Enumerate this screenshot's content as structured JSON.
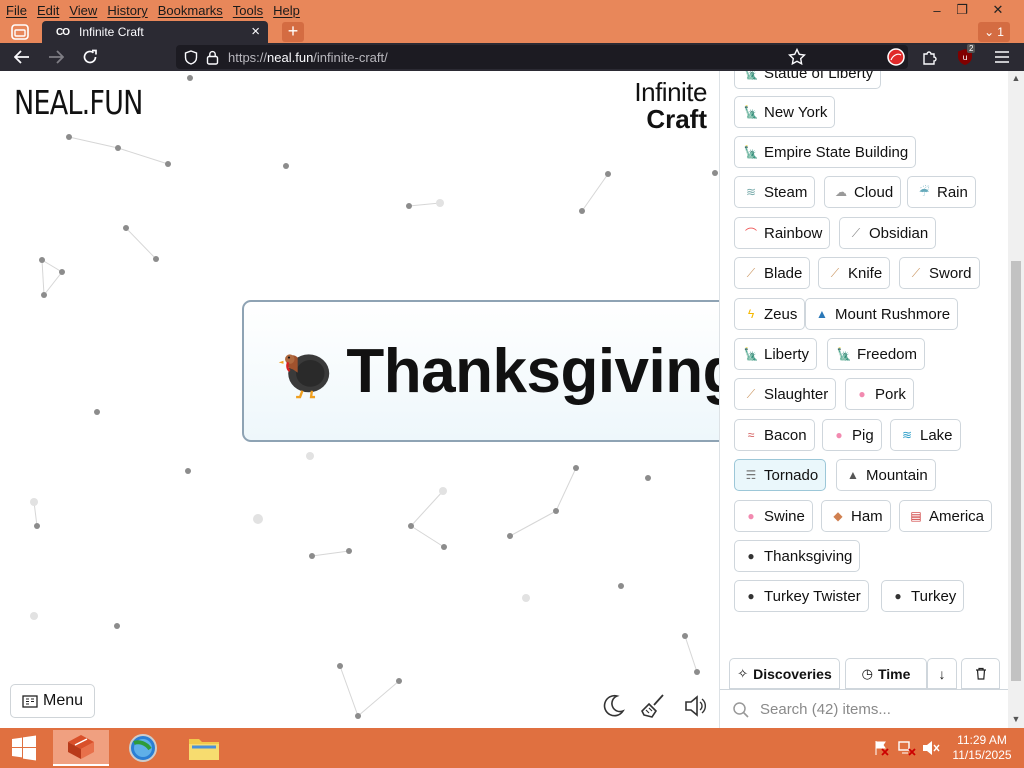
{
  "menubar": {
    "items": [
      "File",
      "Edit",
      "View",
      "History",
      "Bookmarks",
      "Tools",
      "Help"
    ]
  },
  "window_controls": [
    "–",
    "❐",
    "✕"
  ],
  "tab": {
    "title": "Infinite Craft",
    "favicon": "CO",
    "count": "1"
  },
  "navbar": {
    "url_prefix": "https://",
    "url_host": "neal.fun",
    "url_path": "/infinite-craft/",
    "extension_badge": "2"
  },
  "page": {
    "logo": "NEAL.FUN",
    "title_line1": "Infinite",
    "title_line2": "Craft",
    "featured_item": {
      "emoji": "turkey-icon",
      "label": "Thanksgiving"
    },
    "menu_label": "Menu"
  },
  "sidebar": {
    "items": [
      {
        "label": "Statue of Liberty",
        "icon": "statue-of-liberty-icon"
      },
      {
        "label": "New York",
        "icon": "statue-of-liberty-icon"
      },
      {
        "label": "Empire State Building",
        "icon": "statue-of-liberty-icon"
      },
      {
        "label": "Steam",
        "icon": "steam-icon"
      },
      {
        "label": "Cloud",
        "icon": "cloud-icon"
      },
      {
        "label": "Rain",
        "icon": "rain-icon"
      },
      {
        "label": "Rainbow",
        "icon": "rainbow-icon"
      },
      {
        "label": "Obsidian",
        "icon": "knife-icon"
      },
      {
        "label": "Blade",
        "icon": "sword-icon"
      },
      {
        "label": "Knife",
        "icon": "knife-icon"
      },
      {
        "label": "Sword",
        "icon": "sword-icon"
      },
      {
        "label": "Zeus",
        "icon": "lightning-icon"
      },
      {
        "label": "Mount Rushmore",
        "icon": "mountain-icon"
      },
      {
        "label": "Liberty",
        "icon": "statue-of-liberty-icon"
      },
      {
        "label": "Freedom",
        "icon": "statue-of-liberty-icon"
      },
      {
        "label": "Slaughter",
        "icon": "knife-icon"
      },
      {
        "label": "Pork",
        "icon": "pig-icon"
      },
      {
        "label": "Bacon",
        "icon": "bacon-icon"
      },
      {
        "label": "Pig",
        "icon": "pig-icon"
      },
      {
        "label": "Lake",
        "icon": "wave-icon"
      },
      {
        "label": "Tornado",
        "icon": "tornado-icon"
      },
      {
        "label": "Mountain",
        "icon": "mountain-icon"
      },
      {
        "label": "Swine",
        "icon": "pig-icon"
      },
      {
        "label": "Ham",
        "icon": "ham-icon"
      },
      {
        "label": "America",
        "icon": "us-flag-icon"
      },
      {
        "label": "Thanksgiving",
        "icon": "turkey-icon"
      },
      {
        "label": "Turkey Twister",
        "icon": "turkey-icon"
      },
      {
        "label": "Turkey",
        "icon": "turkey-icon"
      }
    ],
    "discoveries_label": "Discoveries",
    "time_label": "Time",
    "sort_arrow": "↓",
    "search_placeholder": "Search (42) items..."
  },
  "taskbar": {
    "time": "11:29 AM",
    "date": "11/15/2025"
  },
  "colors": {
    "browser_chrome": "#e8875a",
    "toolbar_dark": "#2b2a33",
    "taskbar": "#e07040",
    "item_border": "#cfd6dc"
  }
}
